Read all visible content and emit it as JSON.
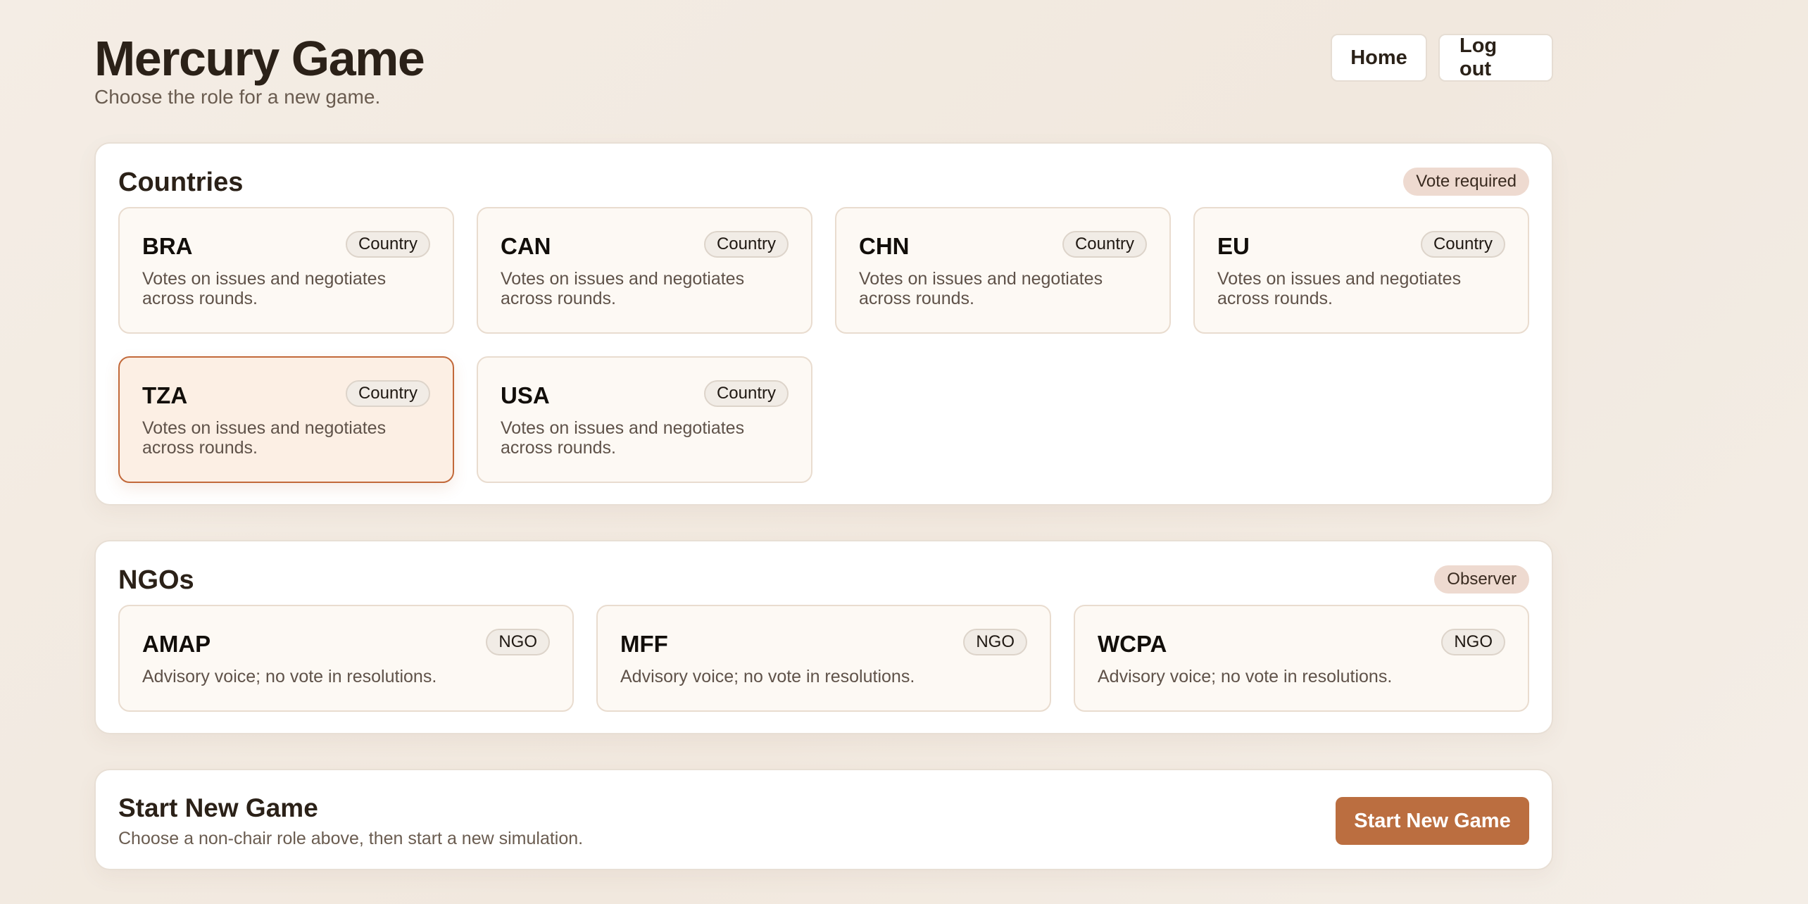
{
  "header": {
    "title": "Mercury Game",
    "subtitle": "Choose the role for a new game.",
    "home_label": "Home",
    "logout_label": "Log out"
  },
  "countries": {
    "title": "Countries",
    "badge": "Vote required",
    "cards": [
      {
        "name": "BRA",
        "tag": "Country",
        "description": "Votes on issues and negotiates across rounds.",
        "selected": false
      },
      {
        "name": "CAN",
        "tag": "Country",
        "description": "Votes on issues and negotiates across rounds.",
        "selected": false
      },
      {
        "name": "CHN",
        "tag": "Country",
        "description": "Votes on issues and negotiates across rounds.",
        "selected": false
      },
      {
        "name": "EU",
        "tag": "Country",
        "description": "Votes on issues and negotiates across rounds.",
        "selected": false
      },
      {
        "name": "TZA",
        "tag": "Country",
        "description": "Votes on issues and negotiates across rounds.",
        "selected": true
      },
      {
        "name": "USA",
        "tag": "Country",
        "description": "Votes on issues and negotiates across rounds.",
        "selected": false
      }
    ]
  },
  "ngos": {
    "title": "NGOs",
    "badge": "Observer",
    "cards": [
      {
        "name": "AMAP",
        "tag": "NGO",
        "description": "Advisory voice; no vote in resolutions."
      },
      {
        "name": "MFF",
        "tag": "NGO",
        "description": "Advisory voice; no vote in resolutions."
      },
      {
        "name": "WCPA",
        "tag": "NGO",
        "description": "Advisory voice; no vote in resolutions."
      }
    ]
  },
  "start": {
    "title": "Start New Game",
    "description": "Choose a non-chair role above, then start a new simulation.",
    "button_label": "Start New Game"
  },
  "colors": {
    "accent": "#bb6e40",
    "selected_border": "#c2693a",
    "badge_bg": "#eedad0"
  }
}
